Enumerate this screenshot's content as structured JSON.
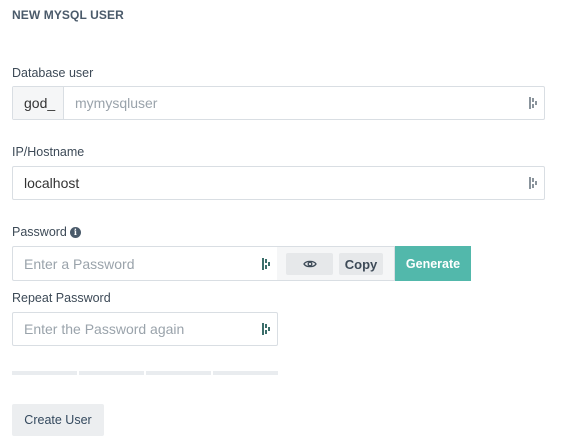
{
  "form": {
    "title": "NEW MYSQL USER",
    "db_user": {
      "label": "Database user",
      "prefix": "god_",
      "value": "",
      "placeholder": "mymysqluser"
    },
    "host": {
      "label": "IP/Hostname",
      "value": "localhost",
      "placeholder": ""
    },
    "password": {
      "label": "Password",
      "info_icon": "i",
      "value": "",
      "placeholder": "Enter a Password",
      "copy_label": "Copy",
      "generate_label": "Generate"
    },
    "repeat_password": {
      "label": "Repeat Password",
      "value": "",
      "placeholder": "Enter the Password again"
    },
    "strength_segments": 4,
    "submit_label": "Create User"
  },
  "icons": {
    "keepass": "password-manager-icon",
    "eye": "eye-icon",
    "info": "info-icon"
  },
  "colors": {
    "accent": "#52b8ab",
    "border": "#d9dee3",
    "text": "#34495e"
  }
}
